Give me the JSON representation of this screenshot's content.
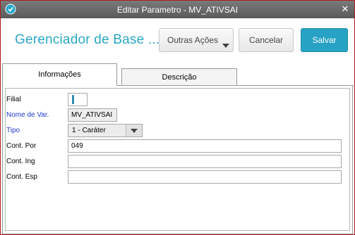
{
  "window": {
    "title": "Editar Parametro - MV_ATIVSAI",
    "app_icon": "app-logo-icon",
    "close_icon": "close-icon"
  },
  "header": {
    "title": "Gerenciador de Base ...",
    "more_actions_label": "Outras Ações",
    "cancel_label": "Cancelar",
    "save_label": "Salvar",
    "save_color": "#27a2c4",
    "title_color": "#2aa7c6"
  },
  "tabs": [
    {
      "label": "Informações",
      "active": true
    },
    {
      "label": "Descrição",
      "active": false
    }
  ],
  "form": {
    "filial": {
      "label": "Filial",
      "value": ""
    },
    "nome_var": {
      "label": "Nome de Var.",
      "value": "MV_ATIVSAI"
    },
    "tipo": {
      "label": "Tipo",
      "value": "1 - Caráter"
    },
    "cont_por": {
      "label": "Cont. Por",
      "value": "049"
    },
    "cont_ing": {
      "label": "Cont. Ing",
      "value": ""
    },
    "cont_esp": {
      "label": "Cont. Esp",
      "value": ""
    }
  }
}
